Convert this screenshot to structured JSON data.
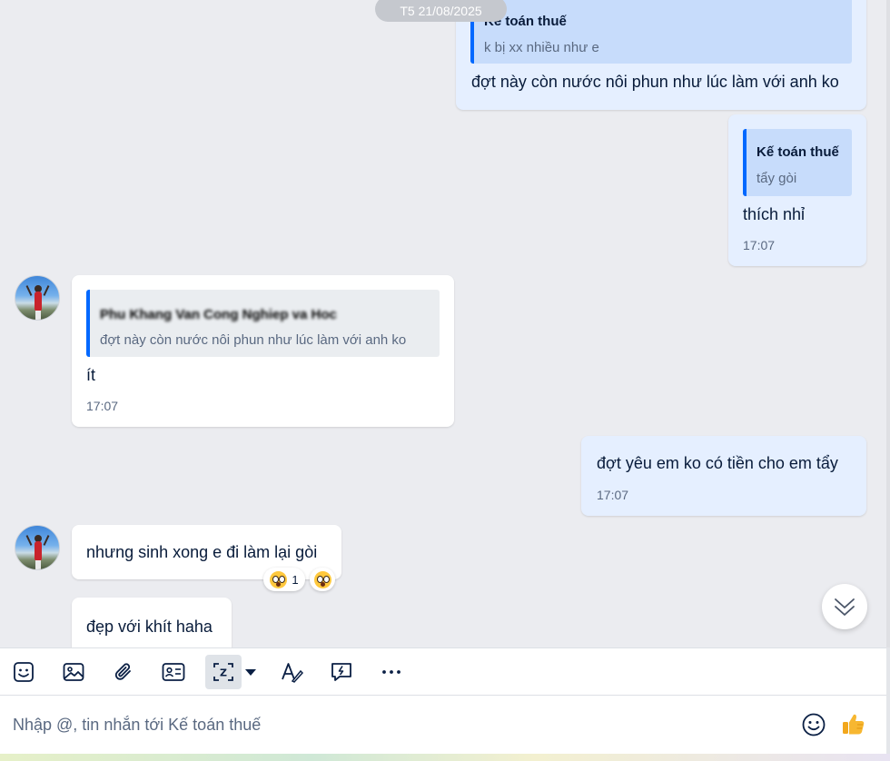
{
  "date_divider": "T5 21/08/2025",
  "messages": {
    "m1": {
      "quote_sender": "Kế toán thuế",
      "quote_text": "k bị xx nhiều như e",
      "text": "đợt này còn nước nôi phun như lúc làm với anh ko"
    },
    "m2": {
      "quote_sender": "Kế toán thuế",
      "quote_text": "tẩy gòi",
      "text": "thích nhỉ",
      "time": "17:07"
    },
    "m3": {
      "quote_sender": "Phu Khang Van Cong Nghiep va Hoc",
      "quote_text": "đợt này còn nước nôi phun như lúc làm với anh ko",
      "text": "ít",
      "time": "17:07"
    },
    "m4": {
      "text": "đợt yêu em ko có tiền cho em tẩy",
      "time": "17:07"
    },
    "m5": {
      "text": "nhưng sinh xong e đi làm lại gòi",
      "reaction_count": "1"
    },
    "m6": {
      "text": "đẹp với khít haha"
    }
  },
  "composer": {
    "placeholder": "Nhập @, tin nhắn tới Kế toán thuế"
  },
  "toolbar_icons": [
    "sticker-icon",
    "image-icon",
    "attachment-icon",
    "contact-card-icon",
    "screenshot-icon",
    "dropdown-caret-icon",
    "text-format-icon",
    "quick-message-icon",
    "more-icon"
  ],
  "colors": {
    "chat_bg": "#ebecf0",
    "outgoing_bubble": "#e5efff",
    "incoming_bubble": "#ffffff",
    "quote_bar": "#0068ff",
    "like_yellow": "#f7b731"
  }
}
